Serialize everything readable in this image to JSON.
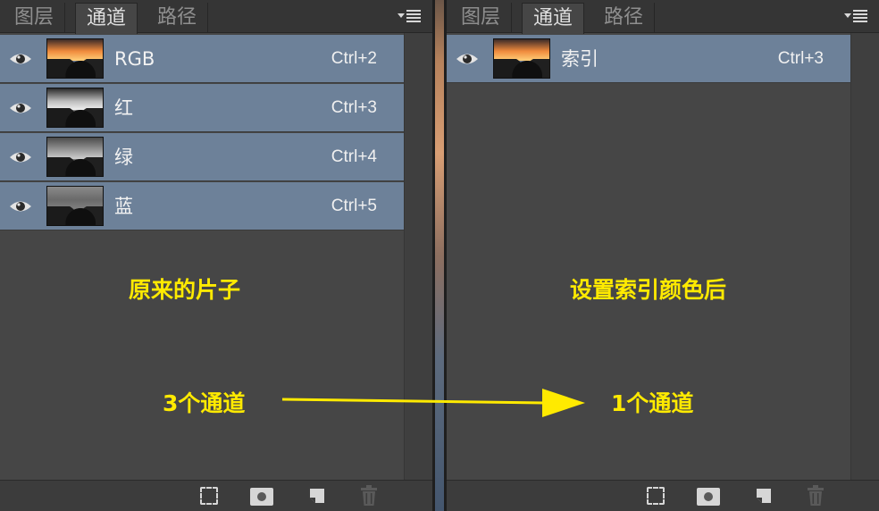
{
  "left_panel": {
    "tabs": [
      {
        "label": "图层",
        "active": false
      },
      {
        "label": "通道",
        "active": true
      },
      {
        "label": "路径",
        "active": false
      }
    ],
    "channels": [
      {
        "name": "RGB",
        "shortcut": "Ctrl+2",
        "visible": true,
        "thumb": "color"
      },
      {
        "name": "红",
        "shortcut": "Ctrl+3",
        "visible": true,
        "thumb": "gray-light"
      },
      {
        "name": "绿",
        "shortcut": "Ctrl+4",
        "visible": true,
        "thumb": "gray-mid"
      },
      {
        "name": "蓝",
        "shortcut": "Ctrl+5",
        "visible": true,
        "thumb": "gray-dark"
      }
    ],
    "annotation": "原来的片子"
  },
  "right_panel": {
    "tabs": [
      {
        "label": "图层",
        "active": false
      },
      {
        "label": "通道",
        "active": true
      },
      {
        "label": "路径",
        "active": false
      }
    ],
    "channels": [
      {
        "name": "索引",
        "shortcut": "Ctrl+3",
        "visible": true,
        "thumb": "color"
      }
    ],
    "annotation": "设置索引颜色后"
  },
  "arrow": {
    "from_label": "3个通道",
    "to_label": "1个通道",
    "color": "#ffea00"
  },
  "colors": {
    "panel_bg": "#464646",
    "row_selected": "#6d8199",
    "annotation": "#ffea00"
  }
}
